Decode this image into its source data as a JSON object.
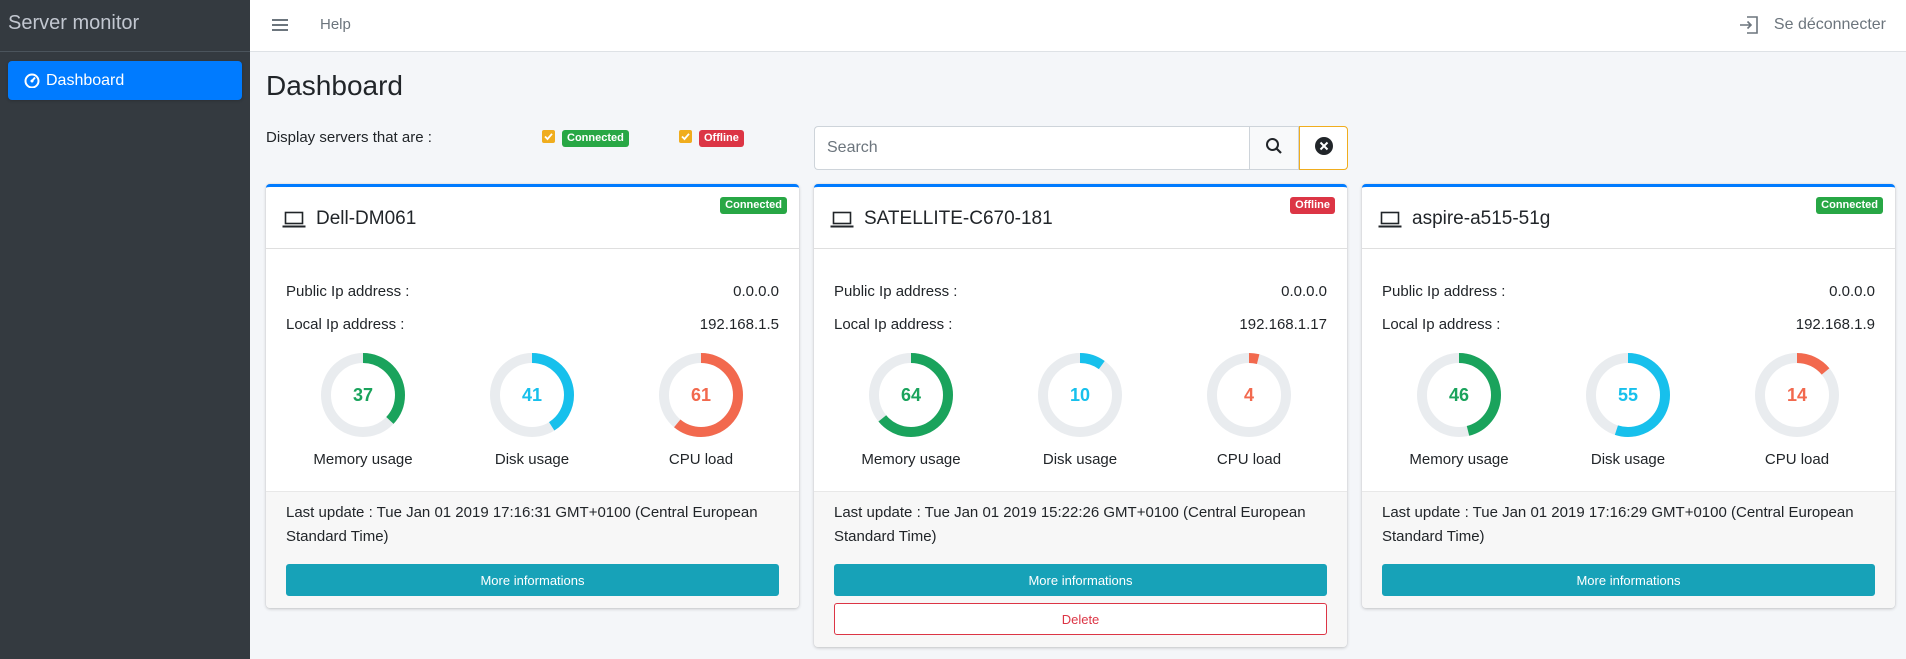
{
  "app": {
    "brand": "Server monitor",
    "nav": [
      {
        "label": "Dashboard",
        "icon": "tachometer-icon",
        "active": true
      }
    ],
    "topbar": {
      "help": "Help",
      "logout": "Se déconnecter"
    }
  },
  "page": {
    "title": "Dashboard",
    "filter_label": "Display servers that are :",
    "filters": [
      {
        "label": "Connected",
        "checked": true,
        "color": "#28a745"
      },
      {
        "label": "Offline",
        "checked": true,
        "color": "#dc3545"
      }
    ],
    "search": {
      "placeholder": "Search",
      "value": ""
    }
  },
  "labels": {
    "public_ip": "Public Ip address :",
    "local_ip": "Local Ip address :",
    "memory": "Memory usage",
    "disk": "Disk usage",
    "cpu": "CPU load",
    "more": "More informations",
    "delete": "Delete"
  },
  "colors": {
    "memory": "#1aa35c",
    "disk": "#17c0ec",
    "cpu": "#f2694e",
    "track": "#e9ecef"
  },
  "servers": [
    {
      "name": "Dell-DM061",
      "status": "Connected",
      "public_ip": "0.0.0.0",
      "local_ip": "192.168.1.5",
      "memory": 37,
      "disk": 41,
      "cpu": 61,
      "last_update": "Last update : Tue Jan 01 2019 17:16:31 GMT+0100 (Central European Standard Time)",
      "deletable": false
    },
    {
      "name": "SATELLITE-C670-181",
      "status": "Offline",
      "public_ip": "0.0.0.0",
      "local_ip": "192.168.1.17",
      "memory": 64,
      "disk": 10,
      "cpu": 4,
      "last_update": "Last update : Tue Jan 01 2019 15:22:26 GMT+0100 (Central European Standard Time)",
      "deletable": true
    },
    {
      "name": "aspire-a515-51g",
      "status": "Connected",
      "public_ip": "0.0.0.0",
      "local_ip": "192.168.1.9",
      "memory": 46,
      "disk": 55,
      "cpu": 14,
      "last_update": "Last update : Tue Jan 01 2019 17:16:29 GMT+0100 (Central European Standard Time)",
      "deletable": false
    }
  ]
}
